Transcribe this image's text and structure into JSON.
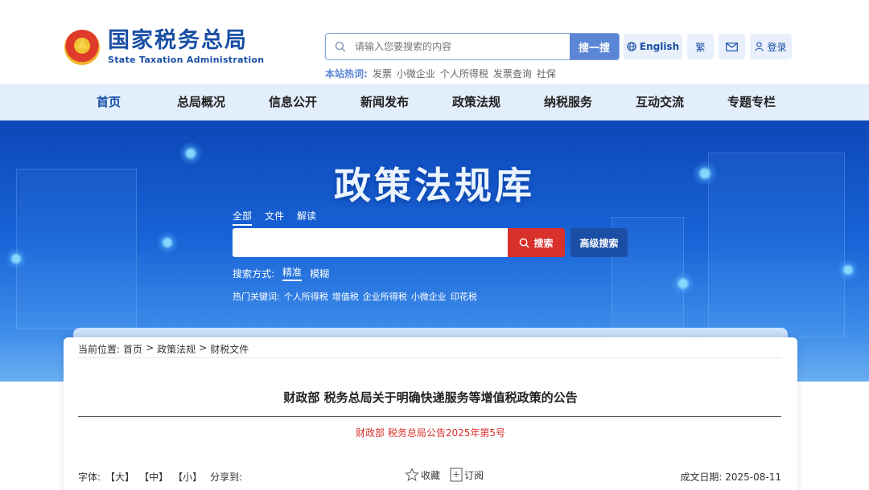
{
  "header": {
    "logo_cn": "国家税务总局",
    "logo_en": "State Taxation Administration",
    "search_placeholder": "请输入您要搜索的内容",
    "search_button": "搜一搜",
    "hot_label": "本站热词:",
    "hot_words": [
      "发票",
      "小微企业",
      "个人所得税",
      "发票查询",
      "社保"
    ],
    "english_label": "English",
    "traditional_label": "繁",
    "login_label": "登录"
  },
  "nav": [
    "首页",
    "总局概况",
    "信息公开",
    "新闻发布",
    "政策法规",
    "纳税服务",
    "互动交流",
    "专题专栏"
  ],
  "banner": {
    "title": "政策法规库",
    "scope_tabs": [
      "全部",
      "文件",
      "解读"
    ],
    "search_button": "搜索",
    "advanced_button": "高级搜索",
    "mode_label": "搜索方式:",
    "modes": [
      "精准",
      "模糊"
    ],
    "hot_keywords_label": "热门关键词:",
    "hot_keywords": [
      "个人所得税",
      "增值税",
      "企业所得税",
      "小微企业",
      "印花税"
    ]
  },
  "article": {
    "breadcrumb_label": "当前位置:",
    "breadcrumb": [
      "首页",
      "政策法规",
      "财税文件"
    ],
    "breadcrumb_sep": ">",
    "title": "财政部 税务总局关于明确快递服务等增值税政策的公告",
    "doc_number": "财政部 税务总局公告2025年第5号",
    "font_label": "字体:",
    "font_sizes": [
      "【大】",
      "【中】",
      "【小】"
    ],
    "share_label": "分享到:",
    "favorite_label": "收藏",
    "subscribe_label": "订阅",
    "date_label": "成文日期:",
    "date_value": "2025-08-11"
  },
  "colors": {
    "brand_blue": "#1a4fa5",
    "search_red": "#d8302a",
    "nav_bg": "#e3eefc"
  }
}
